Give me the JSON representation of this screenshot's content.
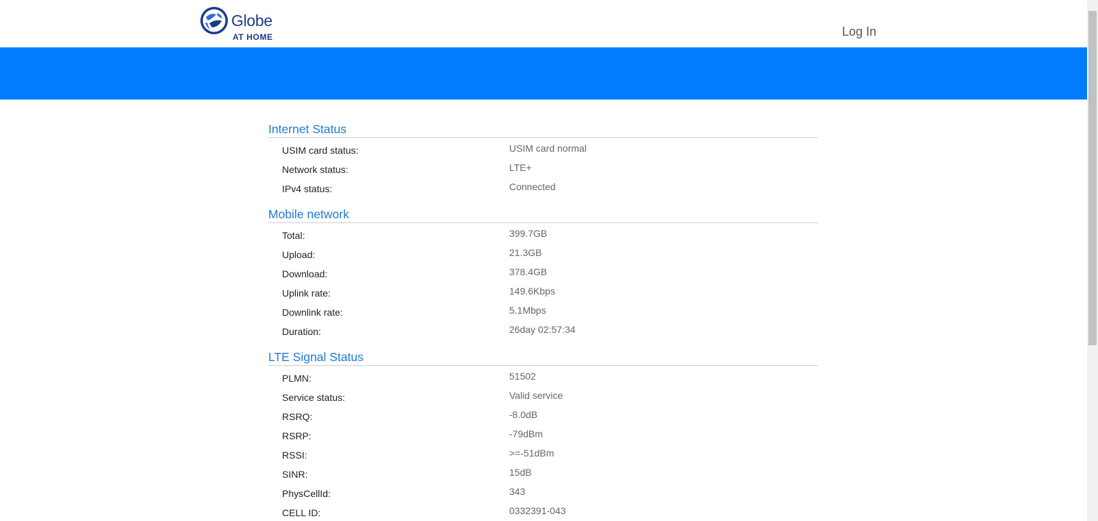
{
  "header": {
    "logo_word": "Globe",
    "logo_sub": "AT HOME",
    "login_label": "Log In"
  },
  "colors": {
    "banner": "#017cfe",
    "section_title": "#1e7bd6",
    "logo": "#1d3a8a"
  },
  "sections": [
    {
      "title": "Internet Status",
      "rows": [
        {
          "label": "USIM card status:",
          "value": "USIM card normal"
        },
        {
          "label": "Network status:",
          "value": "LTE+"
        },
        {
          "label": "IPv4 status:",
          "value": "Connected"
        }
      ]
    },
    {
      "title": "Mobile network",
      "rows": [
        {
          "label": "Total:",
          "value": "399.7GB"
        },
        {
          "label": "Upload:",
          "value": "21.3GB"
        },
        {
          "label": "Download:",
          "value": "378.4GB"
        },
        {
          "label": "Uplink rate:",
          "value": "149.6Kbps"
        },
        {
          "label": "Downlink rate:",
          "value": "5.1Mbps"
        },
        {
          "label": "Duration:",
          "value": "26day 02:57:34"
        }
      ]
    },
    {
      "title": "LTE Signal Status",
      "rows": [
        {
          "label": "PLMN:",
          "value": "51502"
        },
        {
          "label": "Service status:",
          "value": "Valid service"
        },
        {
          "label": "RSRQ:",
          "value": "-8.0dB"
        },
        {
          "label": "RSRP:",
          "value": "-79dBm"
        },
        {
          "label": "RSSI:",
          "value": ">=-51dBm"
        },
        {
          "label": "SINR:",
          "value": "15dB"
        },
        {
          "label": "PhysCellId:",
          "value": "343"
        },
        {
          "label": "CELL ID:",
          "value": "0332391-043"
        }
      ]
    }
  ]
}
